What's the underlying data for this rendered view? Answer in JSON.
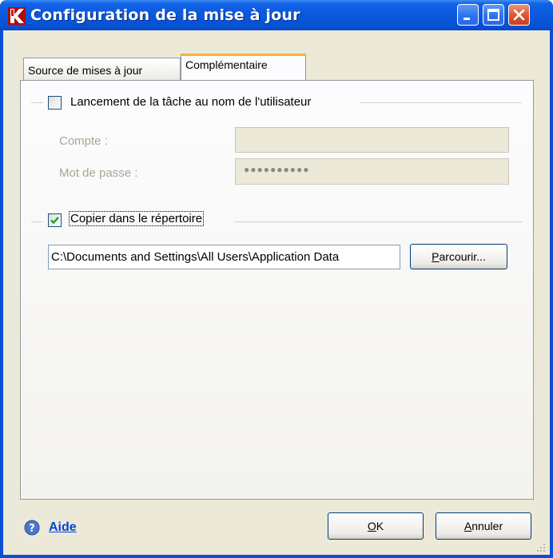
{
  "window": {
    "title": "Configuration de la mise à jour",
    "app_icon": "kaspersky-k-icon"
  },
  "tabs": [
    {
      "label": "Source de mises à jour",
      "active": false
    },
    {
      "label": "Complémentaire",
      "active": true
    }
  ],
  "run_as": {
    "label": "Lancement de la tâche au nom de l'utilisateur",
    "checked": false,
    "account_label": "Compte :",
    "account_value": "",
    "password_label": "Mot de passe :",
    "password_value": "●●●●●●●●●●"
  },
  "copy": {
    "label": "Copier dans le répertoire",
    "checked": true,
    "path": "C:\\Documents and Settings\\All Users\\Application Data",
    "browse_label": "Parcourir..."
  },
  "footer": {
    "help_label": "Aide",
    "ok_label": "OK",
    "cancel_label": "Annuler"
  },
  "colors": {
    "titlebar": "#0a58dc",
    "tab_highlight": "#f9b33c",
    "check": "#21a121",
    "link": "#0046d5"
  }
}
